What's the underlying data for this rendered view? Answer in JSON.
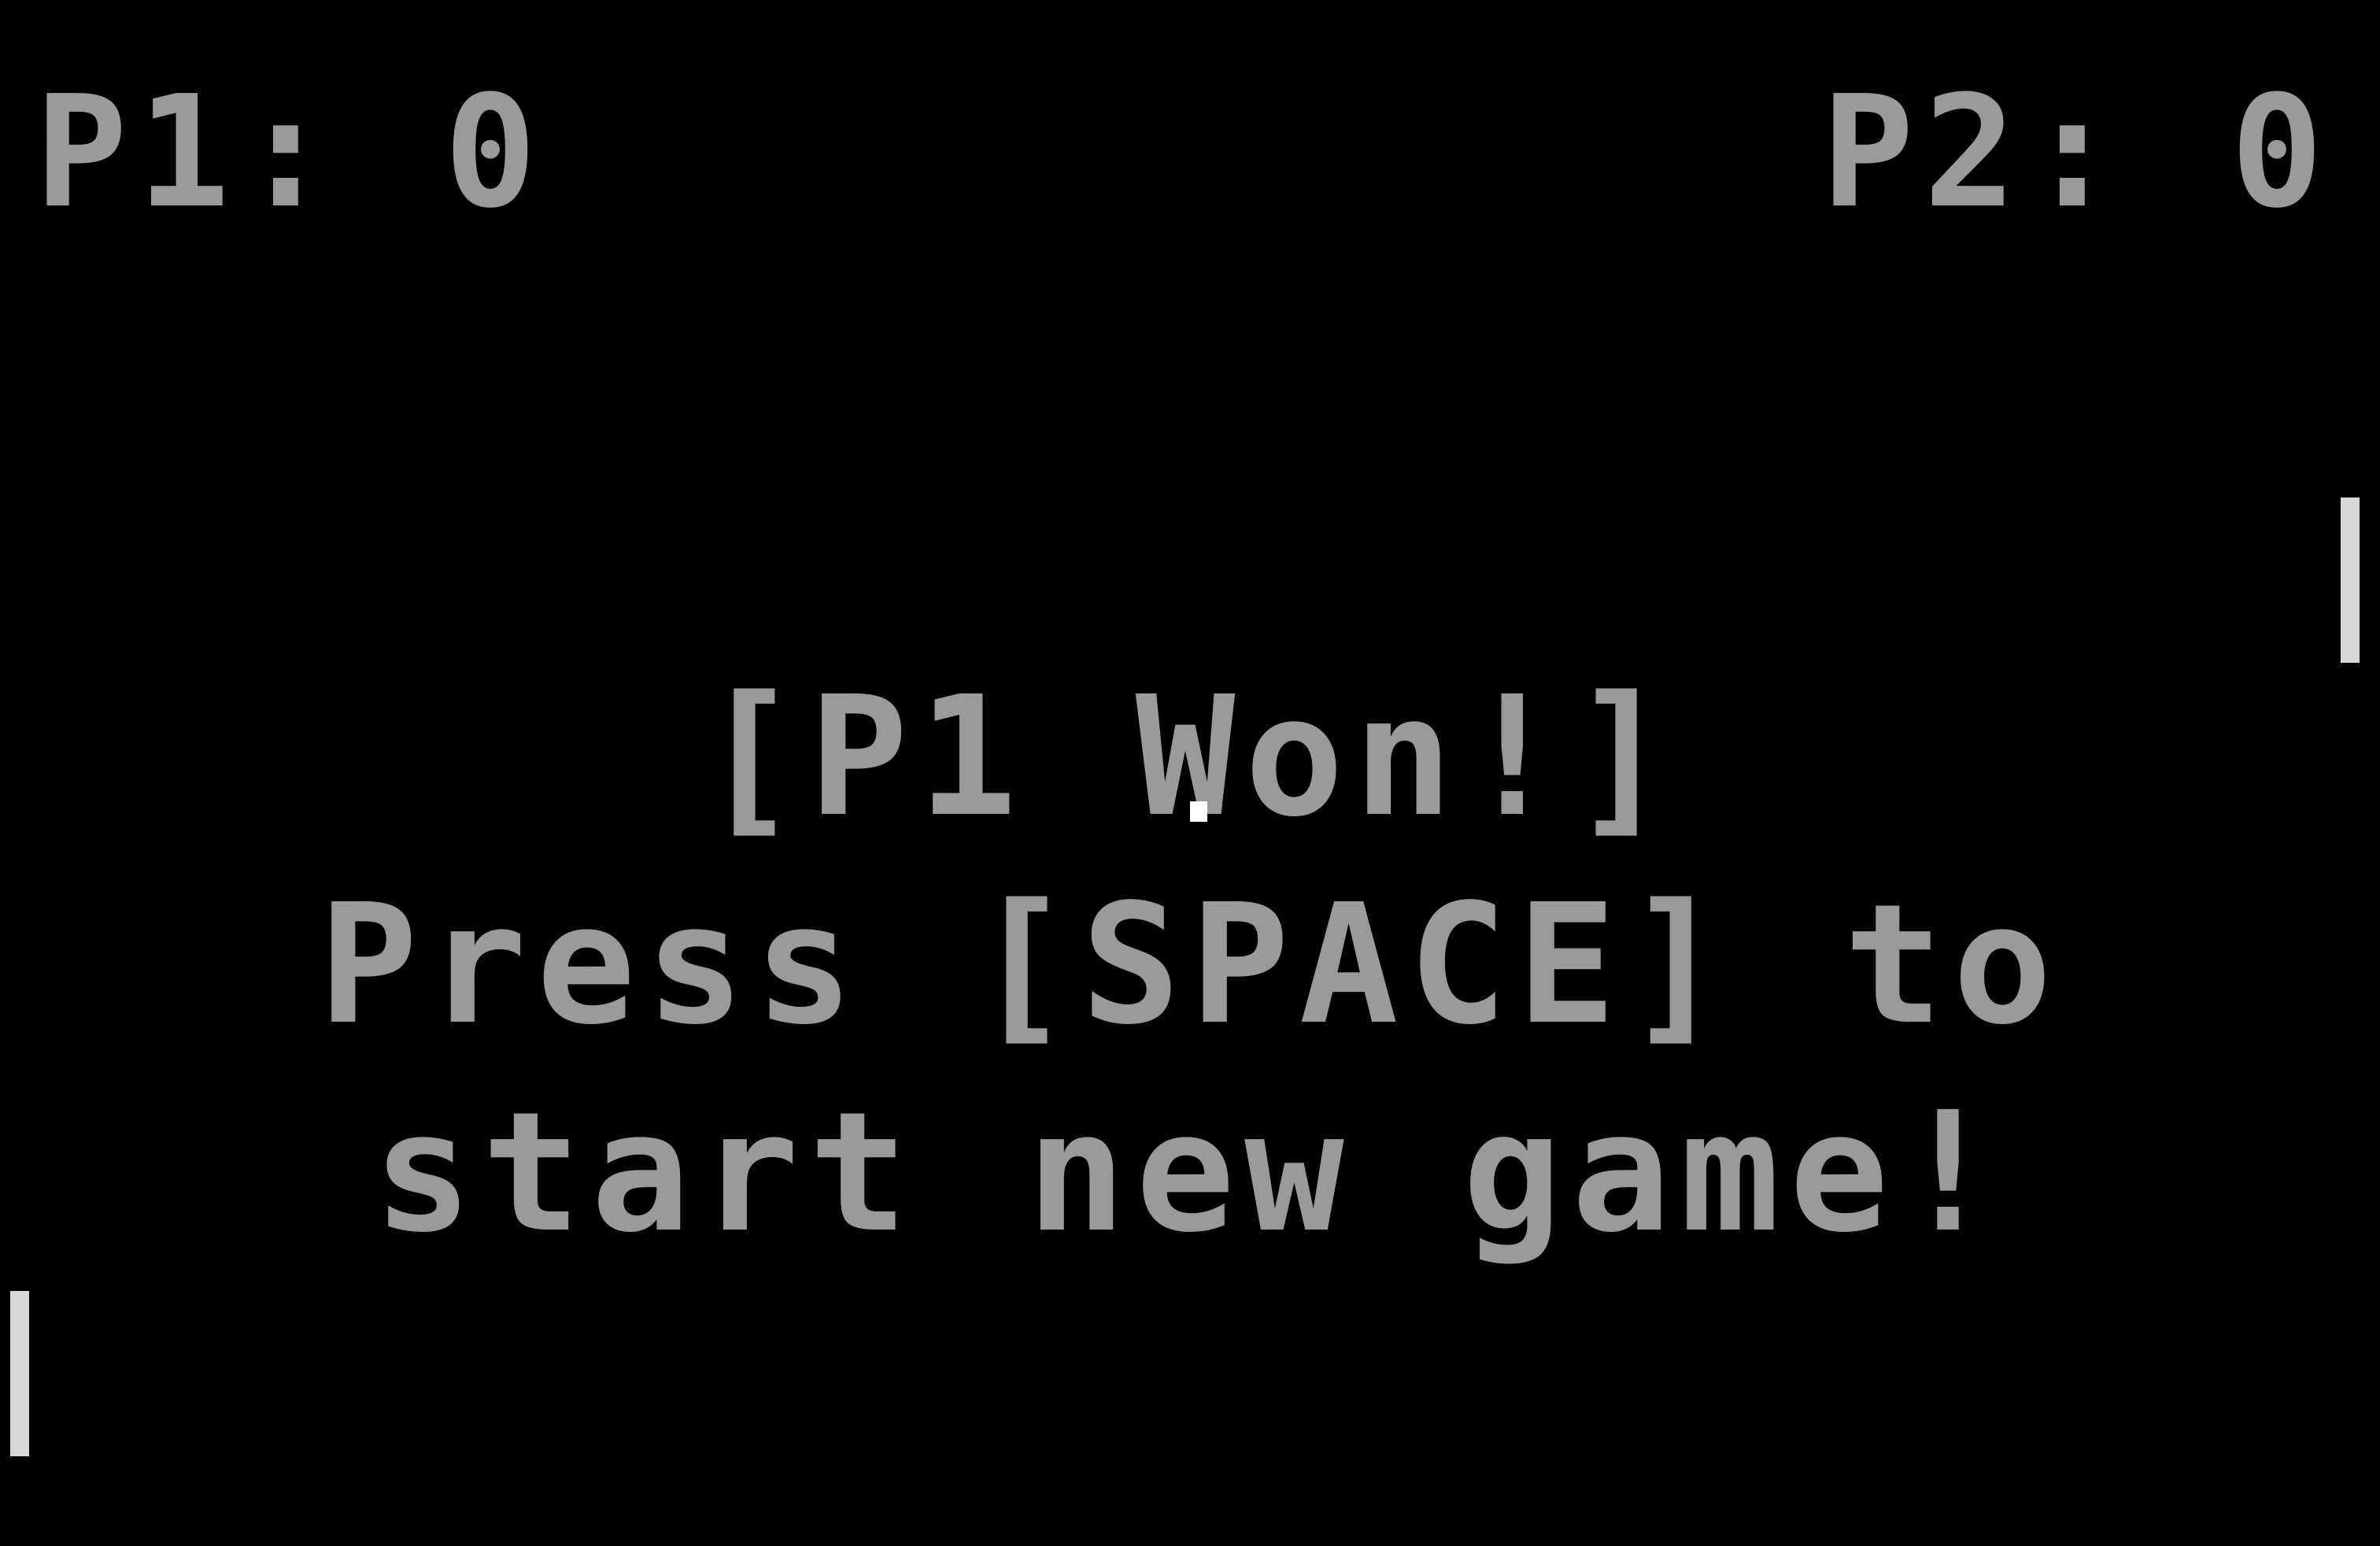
{
  "scores": {
    "p1": "P1: 0",
    "p2": "P2: 0"
  },
  "message": {
    "line1": "[P1 Won!]",
    "line2": "Press [SPACE] to",
    "line3": "start new game!"
  },
  "colors": {
    "background": "#000000",
    "text": "#9a9a9a",
    "paddle": "#d8d8d8",
    "ball": "#ffffff"
  }
}
